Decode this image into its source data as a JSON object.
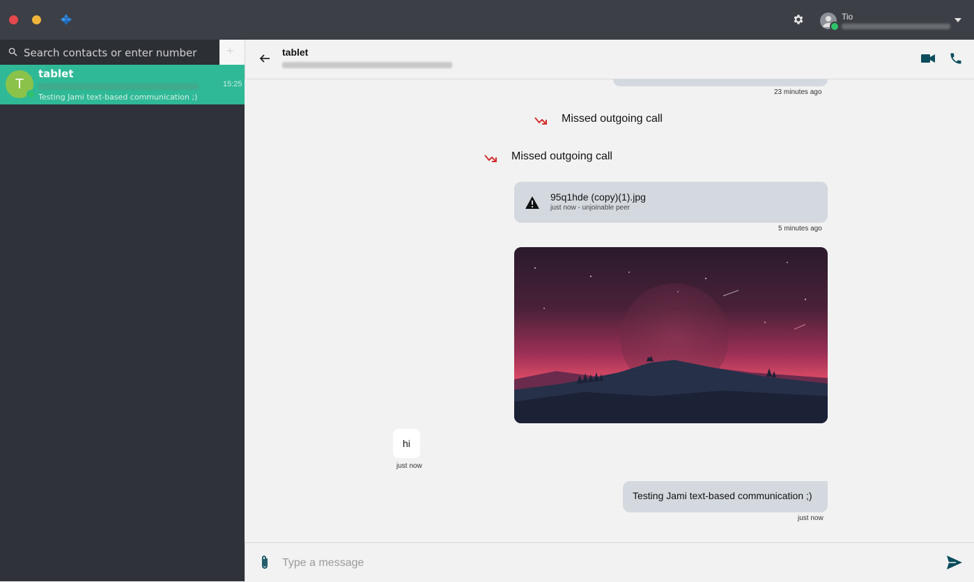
{
  "user": {
    "name": "Tio"
  },
  "search": {
    "placeholder": "Search contacts or enter number",
    "add_label": "+"
  },
  "contact": {
    "initial": "T",
    "name": "tablet",
    "time": "15:25",
    "preview": "Testing Jami text-based communication ;)"
  },
  "chat": {
    "title": "tablet",
    "messages": {
      "prev_timestamp": "23 minutes ago",
      "call1": "Missed outgoing call",
      "call2": "Missed outgoing call",
      "file_name": "95q1hde (copy)(1).jpg",
      "file_status": "just now - unjoinable peer",
      "file_timestamp": "5 minutes ago",
      "hi": "hi",
      "hi_timestamp": "just now",
      "text": "Testing Jami text-based communication ;)",
      "text_timestamp": "just now"
    }
  },
  "composer": {
    "placeholder": "Type a message"
  },
  "colors": {
    "accent": "#2fb996",
    "topbar": "#3c3f45",
    "sidebar": "#2f3238",
    "bubble_out": "#d4d9df",
    "missed_call": "#d32f2f"
  }
}
